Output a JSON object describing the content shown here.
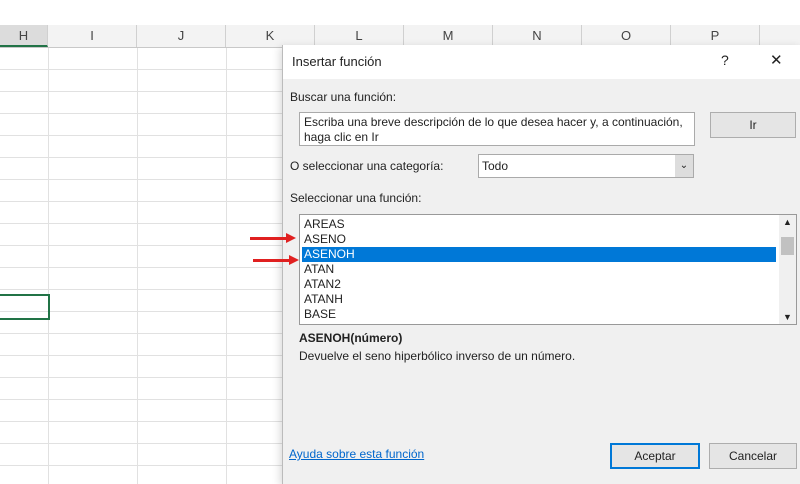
{
  "sheet": {
    "columns": [
      "H",
      "I",
      "J",
      "K",
      "L",
      "M",
      "N",
      "O",
      "P"
    ],
    "selected_column": "H"
  },
  "dialog": {
    "title": "Insertar función",
    "help": "?",
    "close": "✕",
    "search_label": "Buscar una función:",
    "search_value": "Escriba una breve descripción de lo que desea hacer y, a continuación, haga clic en Ir",
    "go_button": "Ir",
    "category_label": "O seleccionar una categoría:",
    "category_value": "Todo",
    "function_label": "Seleccionar una función:",
    "functions": [
      "AREAS",
      "ASENO",
      "ASENOH",
      "ATAN",
      "ATAN2",
      "ATANH",
      "BASE"
    ],
    "selected_function": "ASENOH",
    "signature": "ASENOH(número)",
    "description": "Devuelve el seno hiperbólico inverso de un número.",
    "help_link": "Ayuda sobre esta función",
    "ok_button": "Aceptar",
    "cancel_button": "Cancelar"
  },
  "colors": {
    "selection": "#0078d7",
    "annotation_arrow": "#e02020",
    "excel_green": "#217346"
  }
}
